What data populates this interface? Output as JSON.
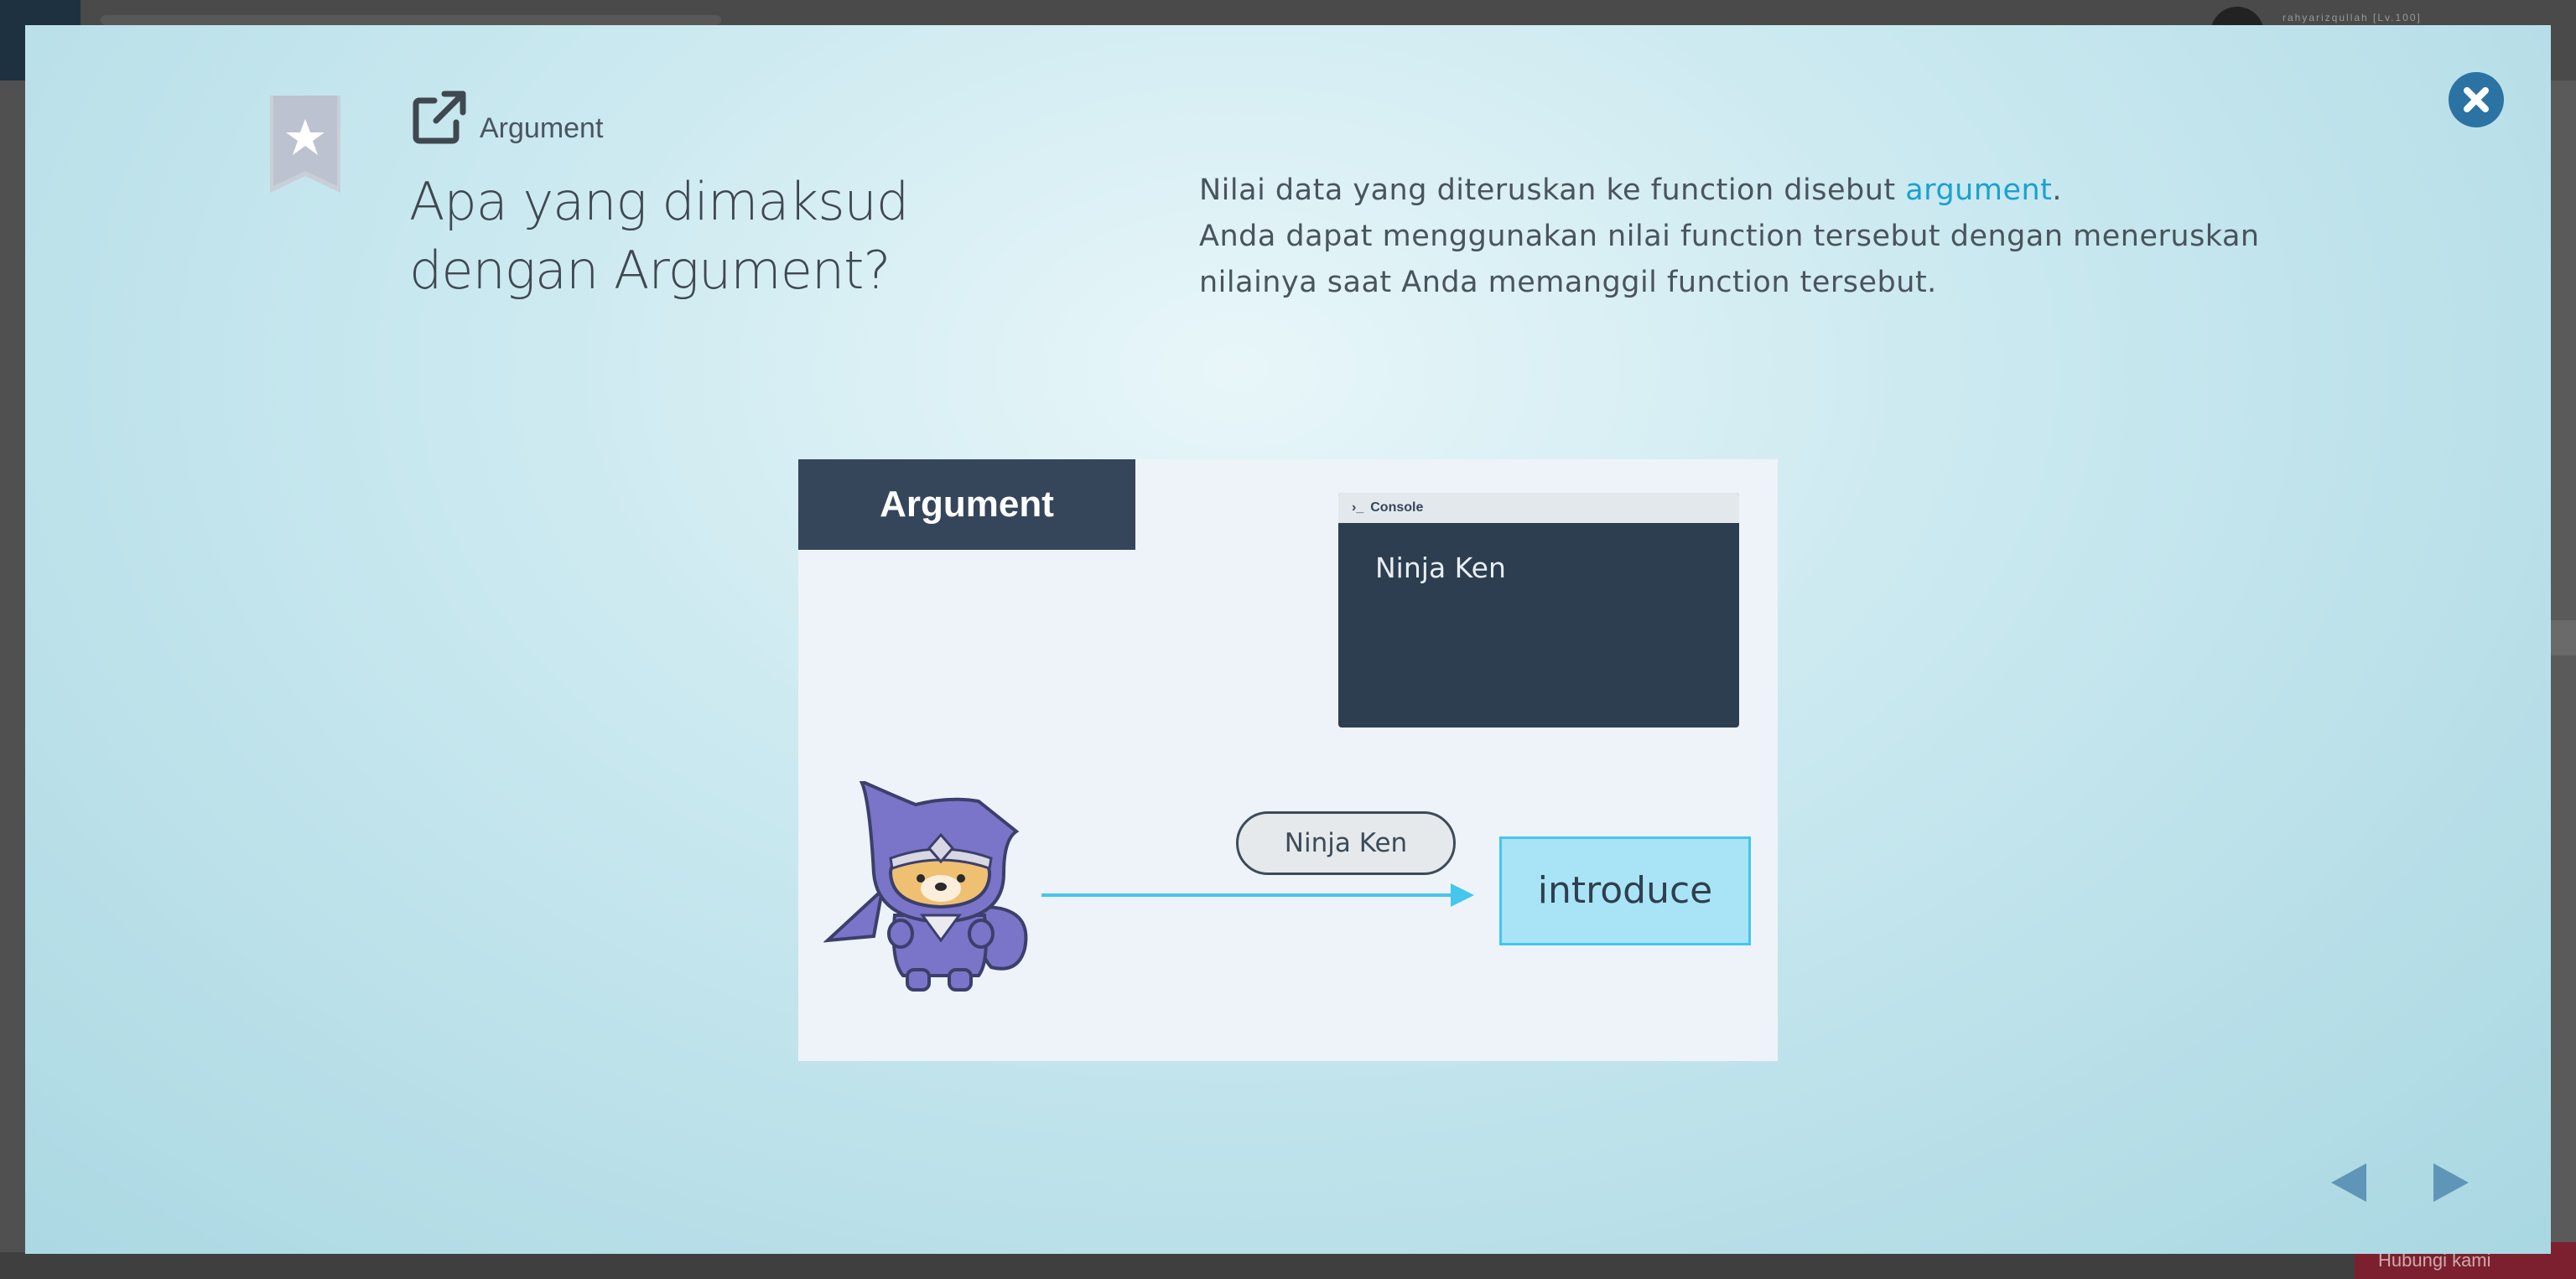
{
  "background": {
    "username": "rahyarizqullah [Lv.100]",
    "bottom_button_label": "Hubungi kami"
  },
  "lesson": {
    "category": "Argument",
    "title": "Apa yang dimaksud dengan Argument?",
    "description": {
      "line1_prefix": "Nilai data yang diteruskan ke function disebut ",
      "line1_keyword": "argument",
      "line1_suffix": ".",
      "line2": "Anda dapat menggunakan nilai function tersebut dengan meneruskan",
      "line3": "nilainya saat Anda memanggil function tersebut."
    }
  },
  "slide": {
    "label": "Argument",
    "console_title": "Console",
    "console_output": "Ninja Ken",
    "argument_value": "Ninja Ken",
    "function_name": "introduce"
  },
  "colors": {
    "accent_link": "#1aa1cf",
    "close_button": "#2b73a3",
    "nav_arrow": "#5f96b8",
    "slide_label_bg": "#35465b",
    "console_bg": "#2c3e50",
    "function_box_bg": "#a8e4f5",
    "arrow": "#45c6ec",
    "ninja_purple": "#7a75c8"
  },
  "icons": {
    "bookmark": "bookmark-star-icon",
    "category": "external-link-icon",
    "close": "close-icon",
    "prev": "triangle-left-icon",
    "next": "triangle-right-icon"
  }
}
